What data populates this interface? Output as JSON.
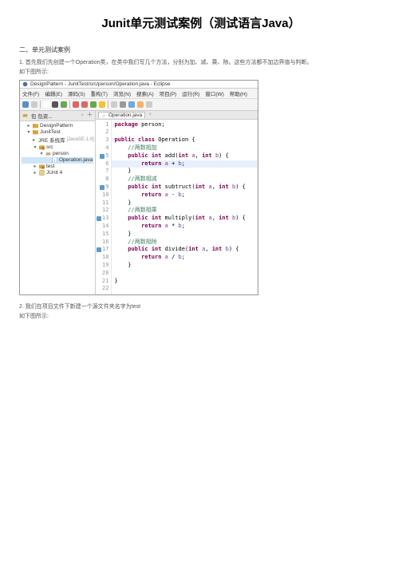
{
  "title": "Junit单元测试案例（测试语言Java）",
  "section_heading": "二、单元测试案例",
  "para1": "1. 首先我们先创建一个Operation类，在类中我们写几个方法，分别为加、减、乘、除。这些方法都不加边界值与判断。",
  "para1b": "如下图所示:",
  "para2": "2. 我们在项目文件下新建一个源文件夹名字为test",
  "para2b": "如下图所示:",
  "ide": {
    "window_title": "DesignPattern - JunitTest/src/person/Operation.java - Eclipse",
    "menu": [
      "文件(F)",
      "编辑(E)",
      "源码(S)",
      "重构(T)",
      "浏览(N)",
      "搜索(A)",
      "项目(P)",
      "运行(R)",
      "窗口(W)",
      "帮助(H)"
    ],
    "toolbar_colors": [
      "#5a8fc7",
      "#ccc",
      "#fff",
      "#555",
      "#6aa84f",
      "#e06666",
      "#e06666",
      "#6aa84f",
      "#f1c232",
      "#ccc",
      "#999",
      "#6fa8dc",
      "#f6b26b",
      "#ccc"
    ],
    "side_tab": "包 包资...",
    "tree": [
      {
        "lvl": 0,
        "arrow": ">",
        "icon": "proj",
        "label": "DesignPattern"
      },
      {
        "lvl": 0,
        "arrow": "v",
        "icon": "proj",
        "label": "JunitTest",
        "sel": false
      },
      {
        "lvl": 1,
        "arrow": ">",
        "icon": "lib",
        "label": "JRE 系统库",
        "extra": "[JavaSE-1.8]"
      },
      {
        "lvl": 1,
        "arrow": "v",
        "icon": "src",
        "label": "src"
      },
      {
        "lvl": 2,
        "arrow": "v",
        "icon": "pkg",
        "label": "person"
      },
      {
        "lvl": 3,
        "arrow": "",
        "icon": "java",
        "label": "Operation.java",
        "sel": true
      },
      {
        "lvl": 1,
        "arrow": ">",
        "icon": "src",
        "label": "test"
      },
      {
        "lvl": 1,
        "arrow": ">",
        "icon": "lib",
        "label": "JUnit 4"
      }
    ],
    "editor_tab": "Operation.java",
    "code": [
      {
        "n": 1,
        "m": "",
        "t": [
          [
            "kw",
            "package"
          ],
          [
            "id",
            " person;"
          ]
        ]
      },
      {
        "n": 2,
        "m": "",
        "t": []
      },
      {
        "n": 3,
        "m": "",
        "t": [
          [
            "kw",
            "public class"
          ],
          [
            "id",
            " Operation {"
          ]
        ]
      },
      {
        "n": 4,
        "m": "",
        "t": [
          [
            "id",
            "    "
          ],
          [
            "cm",
            "//两数相加"
          ]
        ]
      },
      {
        "n": "5",
        "m": "fold",
        "t": [
          [
            "id",
            "    "
          ],
          [
            "kw",
            "public"
          ],
          [
            "id",
            " "
          ],
          [
            "kw",
            "int"
          ],
          [
            "id",
            " add("
          ],
          [
            "kw",
            "int"
          ],
          [
            "id",
            " "
          ],
          [
            "pr",
            "a"
          ],
          [
            "id",
            ", "
          ],
          [
            "kw",
            "int"
          ],
          [
            "id",
            " "
          ],
          [
            "pr",
            "b"
          ],
          [
            "id",
            ") {"
          ]
        ]
      },
      {
        "n": 6,
        "m": "hl",
        "t": [
          [
            "id",
            "        "
          ],
          [
            "kw",
            "return"
          ],
          [
            "id",
            " "
          ],
          [
            "pr",
            "a"
          ],
          [
            "id",
            " + "
          ],
          [
            "pr",
            "b"
          ],
          [
            "id",
            ";"
          ]
        ]
      },
      {
        "n": 7,
        "m": "",
        "t": [
          [
            "id",
            "    }"
          ]
        ]
      },
      {
        "n": 8,
        "m": "",
        "t": [
          [
            "id",
            "    "
          ],
          [
            "cm",
            "//两数相减"
          ]
        ]
      },
      {
        "n": "9",
        "m": "fold",
        "t": [
          [
            "id",
            "    "
          ],
          [
            "kw",
            "public"
          ],
          [
            "id",
            " "
          ],
          [
            "kw",
            "int"
          ],
          [
            "id",
            " subtruct("
          ],
          [
            "kw",
            "int"
          ],
          [
            "id",
            " "
          ],
          [
            "pr",
            "a"
          ],
          [
            "id",
            ", "
          ],
          [
            "kw",
            "int"
          ],
          [
            "id",
            " "
          ],
          [
            "pr",
            "b"
          ],
          [
            "id",
            ") {"
          ]
        ]
      },
      {
        "n": 10,
        "m": "",
        "t": [
          [
            "id",
            "        "
          ],
          [
            "kw",
            "return"
          ],
          [
            "id",
            " "
          ],
          [
            "pr",
            "a"
          ],
          [
            "id",
            " - "
          ],
          [
            "pr",
            "b"
          ],
          [
            "id",
            ";"
          ]
        ]
      },
      {
        "n": 11,
        "m": "",
        "t": [
          [
            "id",
            "    }"
          ]
        ]
      },
      {
        "n": 12,
        "m": "",
        "t": [
          [
            "id",
            "    "
          ],
          [
            "cm",
            "//两数相乘"
          ]
        ]
      },
      {
        "n": "13",
        "m": "fold",
        "t": [
          [
            "id",
            "    "
          ],
          [
            "kw",
            "public"
          ],
          [
            "id",
            " "
          ],
          [
            "kw",
            "int"
          ],
          [
            "id",
            " multiply("
          ],
          [
            "kw",
            "int"
          ],
          [
            "id",
            " "
          ],
          [
            "pr",
            "a"
          ],
          [
            "id",
            ", "
          ],
          [
            "kw",
            "int"
          ],
          [
            "id",
            " "
          ],
          [
            "pr",
            "b"
          ],
          [
            "id",
            ") {"
          ]
        ]
      },
      {
        "n": 14,
        "m": "",
        "t": [
          [
            "id",
            "        "
          ],
          [
            "kw",
            "return"
          ],
          [
            "id",
            " "
          ],
          [
            "pr",
            "a"
          ],
          [
            "id",
            " * "
          ],
          [
            "pr",
            "b"
          ],
          [
            "id",
            ";"
          ]
        ]
      },
      {
        "n": 15,
        "m": "",
        "t": [
          [
            "id",
            "    }"
          ]
        ]
      },
      {
        "n": 16,
        "m": "",
        "t": [
          [
            "id",
            "    "
          ],
          [
            "cm",
            "//两数相除"
          ]
        ]
      },
      {
        "n": "17",
        "m": "fold",
        "t": [
          [
            "id",
            "    "
          ],
          [
            "kw",
            "public"
          ],
          [
            "id",
            " "
          ],
          [
            "kw",
            "int"
          ],
          [
            "id",
            " divide("
          ],
          [
            "kw",
            "int"
          ],
          [
            "id",
            " "
          ],
          [
            "pr",
            "a"
          ],
          [
            "id",
            ", "
          ],
          [
            "kw",
            "int"
          ],
          [
            "id",
            " "
          ],
          [
            "pr",
            "b"
          ],
          [
            "id",
            ") {"
          ]
        ]
      },
      {
        "n": 18,
        "m": "",
        "t": [
          [
            "id",
            "        "
          ],
          [
            "kw",
            "return"
          ],
          [
            "id",
            " "
          ],
          [
            "pr",
            "a"
          ],
          [
            "id",
            " / "
          ],
          [
            "pr",
            "b"
          ],
          [
            "id",
            ";"
          ]
        ]
      },
      {
        "n": 19,
        "m": "",
        "t": [
          [
            "id",
            "    }"
          ]
        ]
      },
      {
        "n": 20,
        "m": "",
        "t": []
      },
      {
        "n": 21,
        "m": "",
        "t": [
          [
            "id",
            "}"
          ]
        ]
      },
      {
        "n": 22,
        "m": "",
        "t": []
      }
    ]
  }
}
